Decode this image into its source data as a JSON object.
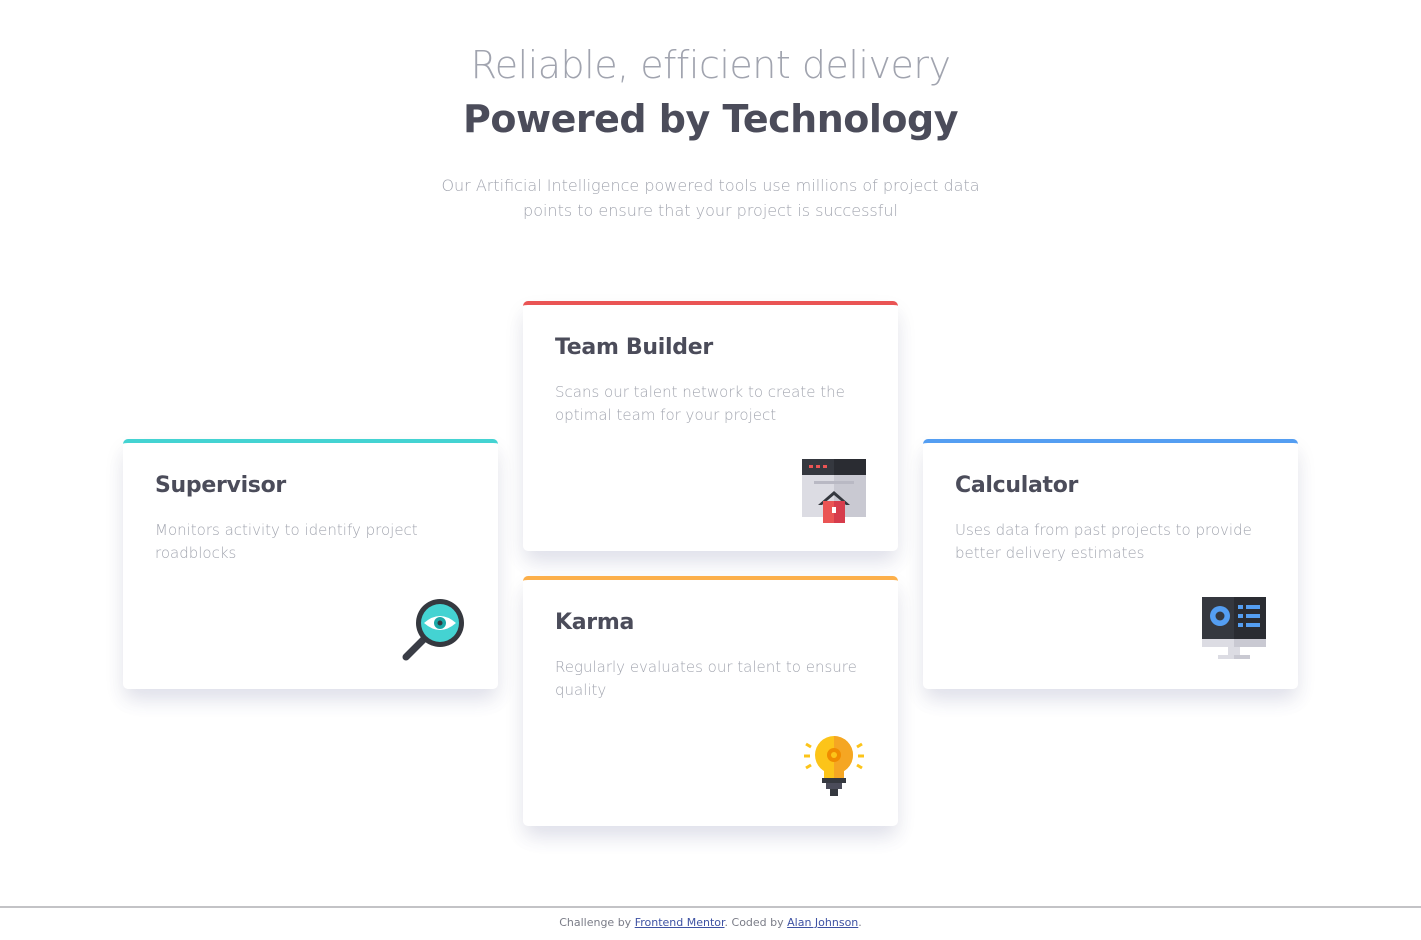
{
  "header": {
    "subtitle": "Reliable, efficient delivery",
    "title": "Powered by Technology",
    "description": "Our Artificial Intelligence powered tools use millions of project data points to ensure that your project is successful"
  },
  "cards": {
    "supervisor": {
      "title": "Supervisor",
      "description": "Monitors activity to identify project roadblocks",
      "icon": "magnifier-eye-icon",
      "accent": "#44d3d2"
    },
    "team_builder": {
      "title": "Team Builder",
      "description": "Scans our talent network to create the optimal team for your project",
      "icon": "browser-house-icon",
      "accent": "#ea5454"
    },
    "karma": {
      "title": "Karma",
      "description": "Regularly evaluates our talent to ensure quality",
      "icon": "lightbulb-icon",
      "accent": "#fcaf4a"
    },
    "calculator": {
      "title": "Calculator",
      "description": "Uses data from past projects to provide better delivery estimates",
      "icon": "monitor-chart-icon",
      "accent": "#549ef2"
    }
  },
  "footer": {
    "prefix": "Challenge by ",
    "link1": "Frontend Mentor",
    "middle": ". Coded by ",
    "link2": "Alan Johnson",
    "suffix": "."
  }
}
